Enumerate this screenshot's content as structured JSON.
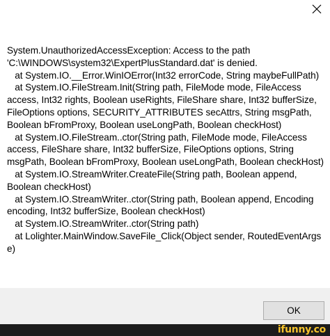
{
  "dialog": {
    "close_label": "Close",
    "message": "System.UnauthorizedAccessException: Access to the path\n'C:\\WINDOWS\\system32\\ExpertPlusStandard.dat' is denied.\n   at System.IO.__Error.WinIOError(Int32 errorCode, String maybeFullPath)\n   at System.IO.FileStream.Init(String path, FileMode mode, FileAccess access, Int32 rights, Boolean useRights, FileShare share, Int32 bufferSize, FileOptions options, SECURITY_ATTRIBUTES secAttrs, String msgPath, Boolean bFromProxy, Boolean useLongPath, Boolean checkHost)\n   at System.IO.FileStream..ctor(String path, FileMode mode, FileAccess access, FileShare share, Int32 bufferSize, FileOptions options, String msgPath, Boolean bFromProxy, Boolean useLongPath, Boolean checkHost)\n   at System.IO.StreamWriter.CreateFile(String path, Boolean append, Boolean checkHost)\n   at System.IO.StreamWriter..ctor(String path, Boolean append, Encoding encoding, Int32 bufferSize, Boolean checkHost)\n   at System.IO.StreamWriter..ctor(String path)\n   at Lolighter.MainWindow.SaveFile_Click(Object sender, RoutedEventArgs e)",
    "ok_label": "OK"
  },
  "watermark": {
    "text": "ifunny.co"
  }
}
